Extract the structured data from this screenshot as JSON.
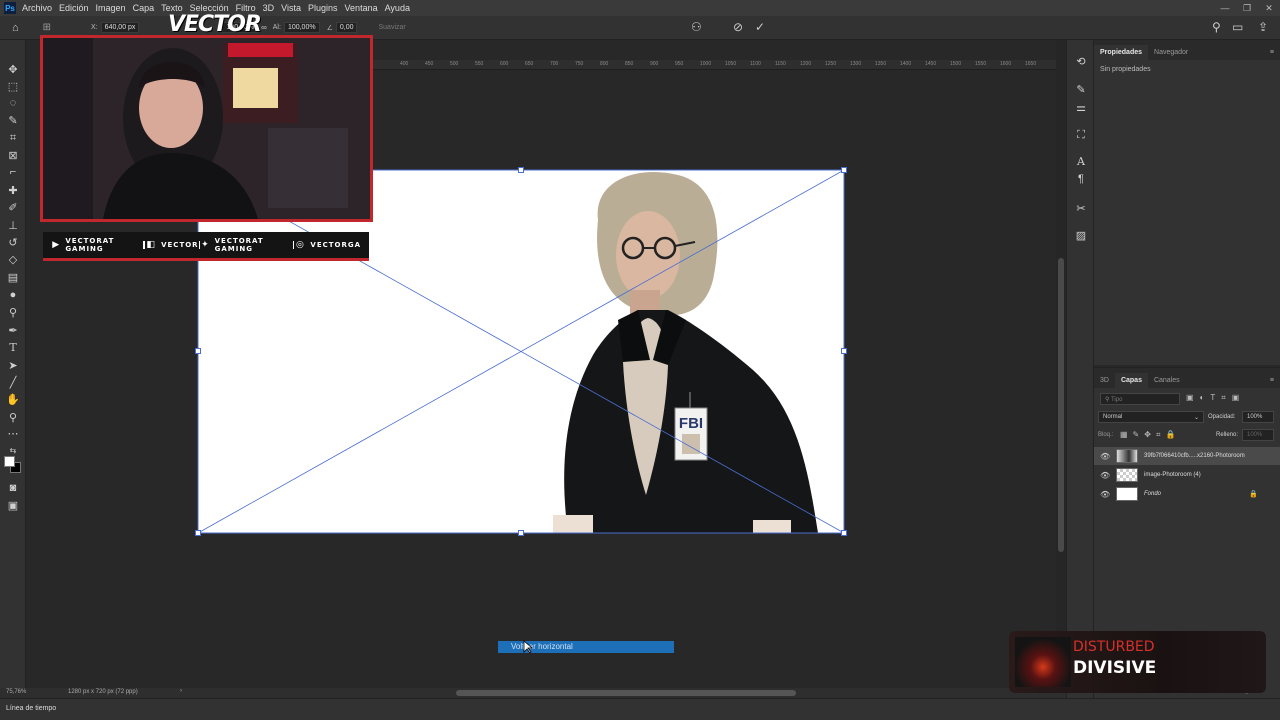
{
  "app": {
    "logo": "Ps",
    "menu": [
      "Archivo",
      "Edición",
      "Imagen",
      "Capa",
      "Texto",
      "Selección",
      "Filtro",
      "3D",
      "Vista",
      "Plugins",
      "Ventana",
      "Ayuda"
    ]
  },
  "options_bar": {
    "x_label": "X:",
    "x_value": "640,00 px",
    "w_value": "100,00%",
    "h_label": "Al:",
    "h_value": "100,00%",
    "angle_value": "0,00",
    "interp": "Suavizar"
  },
  "overlay": {
    "brand": "VECTOR",
    "socials": [
      {
        "icon": "youtube-icon",
        "glyph": "▶",
        "label": "VECTORAT GAMING"
      },
      {
        "icon": "twitch-icon",
        "glyph": "◧",
        "label": "VECTOR"
      },
      {
        "icon": "twitter-icon",
        "glyph": "✦",
        "label": "VECTORAT GAMING"
      },
      {
        "icon": "instagram-icon",
        "glyph": "◎",
        "label": "VECTORGA"
      }
    ],
    "now_playing": {
      "artist": "DISTURBED",
      "album": "DIVISIVE"
    }
  },
  "ruler": {
    "ticks": [
      "400",
      "450",
      "500",
      "550",
      "600",
      "650",
      "700",
      "750",
      "800",
      "850",
      "900",
      "950",
      "1000",
      "1050",
      "1100",
      "1150",
      "1200",
      "1250",
      "1300",
      "1350",
      "1400",
      "1450",
      "1500",
      "1550",
      "1600",
      "1650"
    ]
  },
  "canvas": {
    "badge_text": "FBI"
  },
  "tooltip": "Voltear horizontal",
  "status": {
    "zoom": "75,76%",
    "doc_size": "1280 px x 720 px (72 ppp)"
  },
  "timeline": {
    "label": "Línea de tiempo"
  },
  "properties": {
    "tabs": [
      "Propiedades",
      "Navegador"
    ],
    "active_tab": 0,
    "message": "Sin propiedades"
  },
  "layers_panel": {
    "tabs": [
      "3D",
      "Capas",
      "Canales"
    ],
    "active_tab": 1,
    "filter_placeholder": "Tipo",
    "blend_mode": "Normal",
    "opacity_label": "Opacidad:",
    "opacity_value": "100%",
    "lock_label": "Bloq.:",
    "fill_label": "Relleno:",
    "fill_value": "100%",
    "layers": [
      {
        "name": "39fb7f066410cfb.....x2160-Photoroom",
        "visible": true,
        "selected": true,
        "locked": false
      },
      {
        "name": "image-Photoroom (4)",
        "visible": true,
        "selected": false,
        "locked": false
      },
      {
        "name": "Fondo",
        "visible": true,
        "selected": false,
        "locked": true
      }
    ]
  },
  "colors": {
    "accent_red": "#c0282e",
    "selection_blue": "#1d6fb8",
    "panel_bg": "#323232",
    "canvas_bg": "#282828"
  }
}
